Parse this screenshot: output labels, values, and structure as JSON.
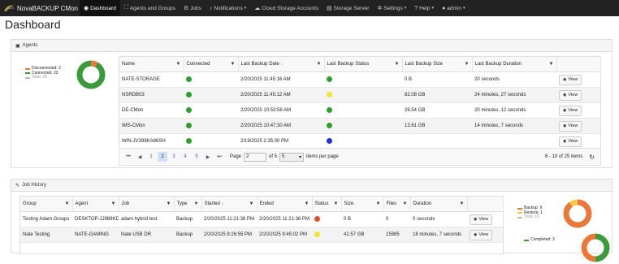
{
  "brand": {
    "title": "NovaBACKUP CMon"
  },
  "nav": [
    {
      "label": "Dashboard",
      "icon": "dashboard-icon",
      "glyph": "◉",
      "caret": false,
      "active": true
    },
    {
      "label": "Agents and Groups",
      "icon": "sitemap-icon",
      "glyph": "⛶",
      "caret": false
    },
    {
      "label": "Jobs",
      "icon": "jobs-icon",
      "glyph": "⚙",
      "caret": false
    },
    {
      "label": "Notifications",
      "icon": "bell-icon",
      "glyph": "♪",
      "caret": true
    },
    {
      "label": "Cloud Storage Accounts",
      "icon": "cloud-icon",
      "glyph": "☁",
      "caret": false
    },
    {
      "label": "Storage Server",
      "icon": "server-icon",
      "glyph": "▤",
      "caret": false
    },
    {
      "label": "Settings",
      "icon": "gear-icon",
      "glyph": "✲",
      "caret": true
    },
    {
      "label": "Help",
      "icon": "question-icon",
      "glyph": "?",
      "caret": true
    },
    {
      "label": "admin",
      "icon": "user-icon",
      "glyph": "●",
      "caret": true
    }
  ],
  "page": {
    "title": "Dashboard"
  },
  "agents_panel": {
    "title": "Agents",
    "legend": [
      {
        "label": "Disconnected: 2",
        "color": "#e8793a"
      },
      {
        "label": "Connected: 23",
        "color": "#3c9a3c"
      },
      {
        "label": "Total: 25",
        "color": "#bbbbbb"
      }
    ],
    "donut": {
      "disconnected": 2,
      "connected": 23,
      "total": 25
    },
    "columns": [
      "Name",
      "Connected",
      "Last Backup Date",
      "Last Backup Status",
      "Last Backup Size",
      "Last Backup Duration"
    ],
    "rows": [
      {
        "name": "NATE-STORAGE",
        "connected": "#2e9e2e",
        "date": "2/20/2025 11:45:16 AM",
        "status": "#2e9e2e",
        "size": "0 B",
        "duration": "20 seconds",
        "view": "View"
      },
      {
        "name": "NSRDB03",
        "connected": "#2e9e2e",
        "date": "2/20/2025 11:45:12 AM",
        "status": "#f2e23a",
        "size": "82.08 GB",
        "duration": "24 minutes, 27 seconds",
        "view": "View"
      },
      {
        "name": "DE-CMon",
        "connected": "#2e9e2e",
        "date": "2/20/2025 10:53:56 AM",
        "status": "#2e9e2e",
        "size": "26.54 GB",
        "duration": "20 minutes, 12 seconds",
        "view": "View"
      },
      {
        "name": "IMS-CMon",
        "connected": "#2e9e2e",
        "date": "2/20/2025 10:47:30 AM",
        "status": "#2e9e2e",
        "size": "13.61 GB",
        "duration": "14 minutes, 7 seconds",
        "view": "View"
      },
      {
        "name": "WIN-JV398KA86SH",
        "connected": "#2e9e2e",
        "date": "2/19/2025 2:35:00 PM",
        "status": "#1f2fd6",
        "size": "",
        "duration": "",
        "view": "View"
      }
    ],
    "pager": {
      "pages": [
        "1",
        "2",
        "3",
        "4",
        "5"
      ],
      "current": "2",
      "page_label": "Page",
      "page_value": "2",
      "of_label": "of 5",
      "per_page": "5",
      "per_page_label": "items per page",
      "summary": "6 - 10 of 25 items"
    }
  },
  "jobs_panel": {
    "title": "Job History",
    "columns": [
      "Group",
      "Agent",
      "Job",
      "Type",
      "Started",
      "Ended",
      "Status",
      "Size",
      "Files",
      "Duration"
    ],
    "rows": [
      {
        "group": "Testing Adam Groups",
        "agent": "DESKTOP-JJ988KD",
        "job": "adam hybrid test",
        "type": "Backup",
        "started": "2/20/2025 11:21:38 PM",
        "ended": "2/20/2025 11:21:38 PM",
        "status": "#e0502a",
        "size": "0 B",
        "files": "0",
        "duration": "0 seconds",
        "view": "View"
      },
      {
        "group": "Nate Testing",
        "agent": "NATE-GAMING",
        "job": "Nate USB DR",
        "type": "Backup",
        "started": "2/20/2025 9:26:55 PM",
        "ended": "2/20/2025 9:45:02 PM",
        "status": "#f2e23a",
        "size": "42.57 GB",
        "files": "15985",
        "duration": "18 minutes, 7 seconds",
        "view": "View"
      }
    ],
    "legend1": [
      {
        "label": "Backup: 9",
        "color": "#e8793a"
      },
      {
        "label": "Restore: 1",
        "color": "#f2c94a"
      },
      {
        "label": "Total: 10",
        "color": "#bbbbbb"
      }
    ],
    "legend2": [
      {
        "label": "Completed: 3",
        "color": "#3c9a3c"
      }
    ]
  }
}
